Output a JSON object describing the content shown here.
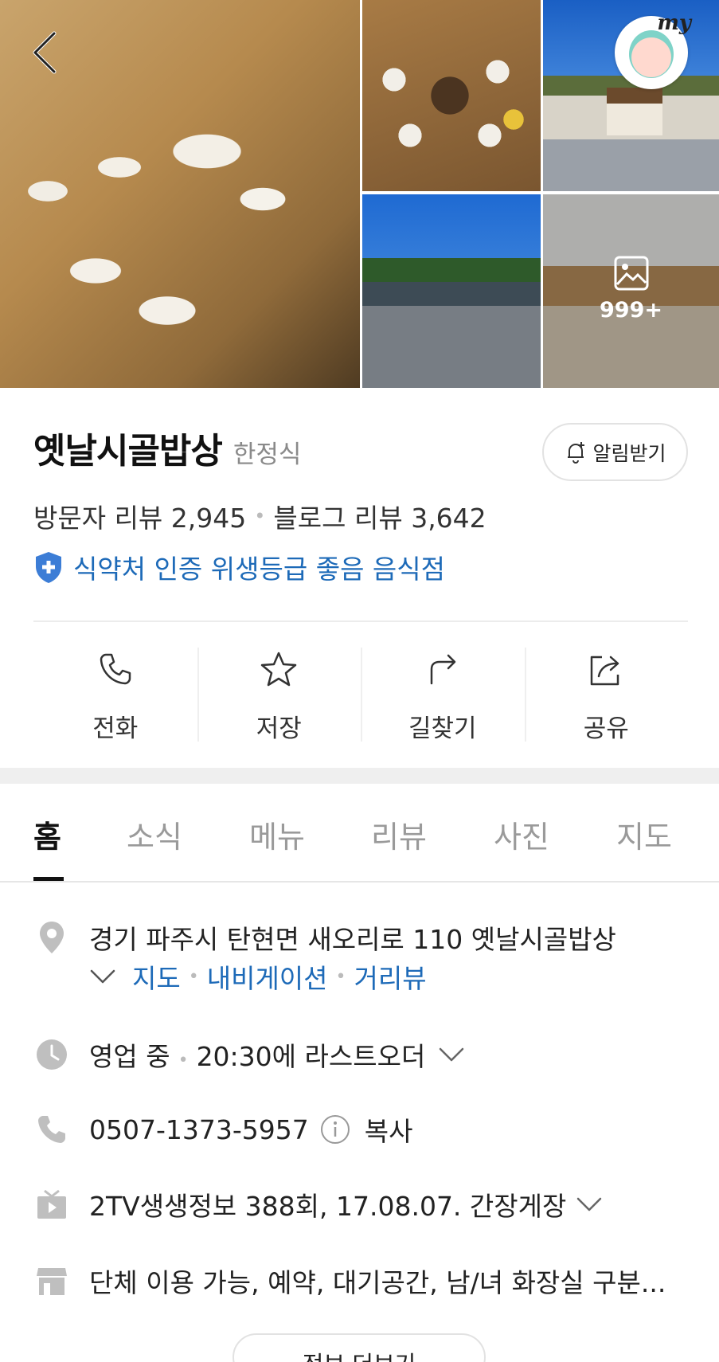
{
  "gallery": {
    "photo_count": "999+",
    "my_label": "my"
  },
  "place": {
    "name": "옛날시골밥상",
    "category": "한정식",
    "alert_label": "알림받기",
    "visitor_reviews": "방문자 리뷰 2,945",
    "blog_reviews": "블로그 리뷰 3,642",
    "hygiene_badge": "식약처 인증 위생등급 좋음 음식점"
  },
  "actions": [
    {
      "label": "전화",
      "icon": "phone-icon"
    },
    {
      "label": "저장",
      "icon": "star-icon"
    },
    {
      "label": "길찾기",
      "icon": "directions-icon"
    },
    {
      "label": "공유",
      "icon": "share-icon"
    }
  ],
  "tabs": [
    {
      "label": "홈",
      "active": true
    },
    {
      "label": "소식"
    },
    {
      "label": "메뉴"
    },
    {
      "label": "리뷰"
    },
    {
      "label": "사진"
    },
    {
      "label": "지도"
    }
  ],
  "info": {
    "address": "경기 파주시 탄현면 새오리로 110 옛날시골밥상",
    "address_links": [
      "지도",
      "내비게이션",
      "거리뷰"
    ],
    "hours_status": "영업 중",
    "hours_detail": "20:30에 라스트오더",
    "phone": "0507-1373-5957",
    "copy_label": "복사",
    "tv": "2TV생생정보 388회, 17.08.07. 간장게장",
    "amenities": "단체 이용 가능, 예약, 대기공간, 남/녀 화장실 구분...",
    "more_label": "정보 더보기"
  },
  "colors": {
    "accent_blue": "#1d6ab8",
    "icon_gray": "#bfbfbf"
  }
}
